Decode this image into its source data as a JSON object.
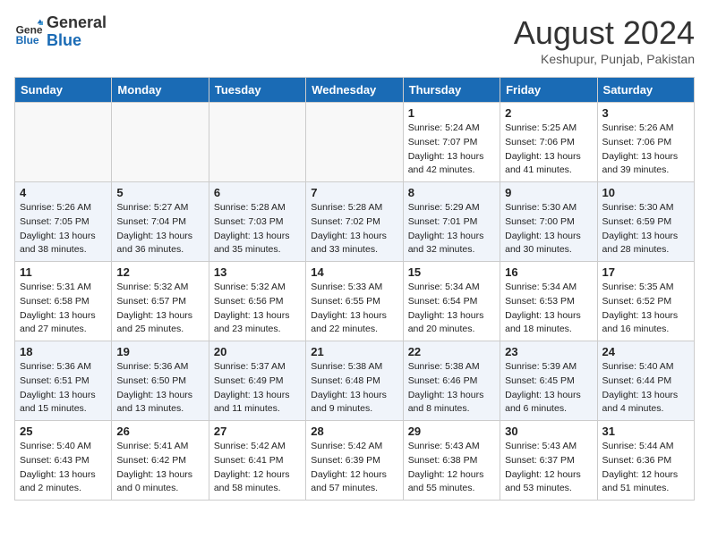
{
  "header": {
    "logo_line1": "General",
    "logo_line2": "Blue",
    "month": "August 2024",
    "location": "Keshupur, Punjab, Pakistan"
  },
  "weekdays": [
    "Sunday",
    "Monday",
    "Tuesday",
    "Wednesday",
    "Thursday",
    "Friday",
    "Saturday"
  ],
  "weeks": [
    [
      {
        "day": "",
        "info": ""
      },
      {
        "day": "",
        "info": ""
      },
      {
        "day": "",
        "info": ""
      },
      {
        "day": "",
        "info": ""
      },
      {
        "day": "1",
        "info": "Sunrise: 5:24 AM\nSunset: 7:07 PM\nDaylight: 13 hours\nand 42 minutes."
      },
      {
        "day": "2",
        "info": "Sunrise: 5:25 AM\nSunset: 7:06 PM\nDaylight: 13 hours\nand 41 minutes."
      },
      {
        "day": "3",
        "info": "Sunrise: 5:26 AM\nSunset: 7:06 PM\nDaylight: 13 hours\nand 39 minutes."
      }
    ],
    [
      {
        "day": "4",
        "info": "Sunrise: 5:26 AM\nSunset: 7:05 PM\nDaylight: 13 hours\nand 38 minutes."
      },
      {
        "day": "5",
        "info": "Sunrise: 5:27 AM\nSunset: 7:04 PM\nDaylight: 13 hours\nand 36 minutes."
      },
      {
        "day": "6",
        "info": "Sunrise: 5:28 AM\nSunset: 7:03 PM\nDaylight: 13 hours\nand 35 minutes."
      },
      {
        "day": "7",
        "info": "Sunrise: 5:28 AM\nSunset: 7:02 PM\nDaylight: 13 hours\nand 33 minutes."
      },
      {
        "day": "8",
        "info": "Sunrise: 5:29 AM\nSunset: 7:01 PM\nDaylight: 13 hours\nand 32 minutes."
      },
      {
        "day": "9",
        "info": "Sunrise: 5:30 AM\nSunset: 7:00 PM\nDaylight: 13 hours\nand 30 minutes."
      },
      {
        "day": "10",
        "info": "Sunrise: 5:30 AM\nSunset: 6:59 PM\nDaylight: 13 hours\nand 28 minutes."
      }
    ],
    [
      {
        "day": "11",
        "info": "Sunrise: 5:31 AM\nSunset: 6:58 PM\nDaylight: 13 hours\nand 27 minutes."
      },
      {
        "day": "12",
        "info": "Sunrise: 5:32 AM\nSunset: 6:57 PM\nDaylight: 13 hours\nand 25 minutes."
      },
      {
        "day": "13",
        "info": "Sunrise: 5:32 AM\nSunset: 6:56 PM\nDaylight: 13 hours\nand 23 minutes."
      },
      {
        "day": "14",
        "info": "Sunrise: 5:33 AM\nSunset: 6:55 PM\nDaylight: 13 hours\nand 22 minutes."
      },
      {
        "day": "15",
        "info": "Sunrise: 5:34 AM\nSunset: 6:54 PM\nDaylight: 13 hours\nand 20 minutes."
      },
      {
        "day": "16",
        "info": "Sunrise: 5:34 AM\nSunset: 6:53 PM\nDaylight: 13 hours\nand 18 minutes."
      },
      {
        "day": "17",
        "info": "Sunrise: 5:35 AM\nSunset: 6:52 PM\nDaylight: 13 hours\nand 16 minutes."
      }
    ],
    [
      {
        "day": "18",
        "info": "Sunrise: 5:36 AM\nSunset: 6:51 PM\nDaylight: 13 hours\nand 15 minutes."
      },
      {
        "day": "19",
        "info": "Sunrise: 5:36 AM\nSunset: 6:50 PM\nDaylight: 13 hours\nand 13 minutes."
      },
      {
        "day": "20",
        "info": "Sunrise: 5:37 AM\nSunset: 6:49 PM\nDaylight: 13 hours\nand 11 minutes."
      },
      {
        "day": "21",
        "info": "Sunrise: 5:38 AM\nSunset: 6:48 PM\nDaylight: 13 hours\nand 9 minutes."
      },
      {
        "day": "22",
        "info": "Sunrise: 5:38 AM\nSunset: 6:46 PM\nDaylight: 13 hours\nand 8 minutes."
      },
      {
        "day": "23",
        "info": "Sunrise: 5:39 AM\nSunset: 6:45 PM\nDaylight: 13 hours\nand 6 minutes."
      },
      {
        "day": "24",
        "info": "Sunrise: 5:40 AM\nSunset: 6:44 PM\nDaylight: 13 hours\nand 4 minutes."
      }
    ],
    [
      {
        "day": "25",
        "info": "Sunrise: 5:40 AM\nSunset: 6:43 PM\nDaylight: 13 hours\nand 2 minutes."
      },
      {
        "day": "26",
        "info": "Sunrise: 5:41 AM\nSunset: 6:42 PM\nDaylight: 13 hours\nand 0 minutes."
      },
      {
        "day": "27",
        "info": "Sunrise: 5:42 AM\nSunset: 6:41 PM\nDaylight: 12 hours\nand 58 minutes."
      },
      {
        "day": "28",
        "info": "Sunrise: 5:42 AM\nSunset: 6:39 PM\nDaylight: 12 hours\nand 57 minutes."
      },
      {
        "day": "29",
        "info": "Sunrise: 5:43 AM\nSunset: 6:38 PM\nDaylight: 12 hours\nand 55 minutes."
      },
      {
        "day": "30",
        "info": "Sunrise: 5:43 AM\nSunset: 6:37 PM\nDaylight: 12 hours\nand 53 minutes."
      },
      {
        "day": "31",
        "info": "Sunrise: 5:44 AM\nSunset: 6:36 PM\nDaylight: 12 hours\nand 51 minutes."
      }
    ]
  ]
}
